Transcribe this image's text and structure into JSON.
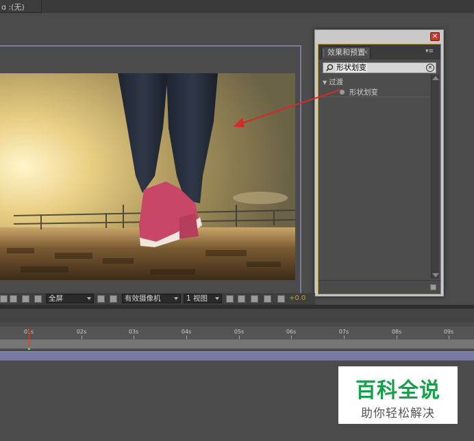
{
  "topbar": {
    "label": "ɑ :(无)"
  },
  "effects_panel": {
    "tab_label": "效果和预置",
    "close_glyph": "✕",
    "menu_glyph": "▾≡",
    "search_value": "形状划变",
    "tree": {
      "category": "过渡",
      "effect": "形状划变"
    }
  },
  "viewer_toolbar": {
    "resolution": "全屏",
    "camera": "有效摄像机",
    "views": "1 视图",
    "exposure": "+0.0"
  },
  "timeline": {
    "ticks": [
      "01s",
      "02s",
      "03s",
      "04s",
      "05s",
      "06s",
      "07s",
      "08s",
      "09s"
    ]
  },
  "watermark": {
    "title": "百科全说",
    "subtitle": "助你轻松解决"
  },
  "colors": {
    "annotation_arrow": "#d42a2a",
    "layer_bar": "#7a79a6",
    "panel_border": "#b58a2a",
    "watermark_green": "#16a04a"
  }
}
